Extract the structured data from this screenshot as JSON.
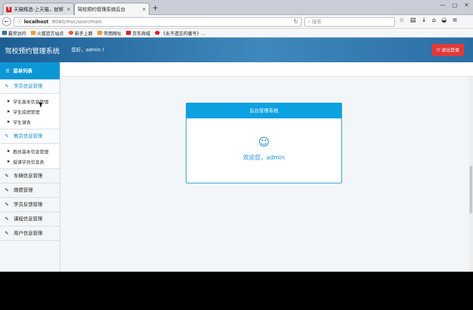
{
  "browser": {
    "tabs": [
      {
        "title": "天猫精选-上天猫，就够了",
        "favicon": "T"
      },
      {
        "title": "驾校预约管理系统后台"
      }
    ],
    "new_tab": "+",
    "url_host": "localhost",
    "url_path": ":8080/mvc/user/main",
    "search_placeholder": "搜索",
    "bookmarks": [
      {
        "label": "最常访问",
        "color": "#3b6fb6"
      },
      {
        "label": "火狐官方站点",
        "color": "#e8a33a"
      },
      {
        "label": "新手上路",
        "color": "#e2622b"
      },
      {
        "label": "常用网址",
        "color": "#e8a33a"
      },
      {
        "label": "京东商城",
        "color": "#d8232a"
      },
      {
        "label": "《永不遗忘的番号》...",
        "color": "#d8232a"
      }
    ]
  },
  "app": {
    "brand": "驾校预约管理系统",
    "greeting": "您好，admin !",
    "logout_label": "退出登录",
    "menu_title": "菜单列表",
    "groups": {
      "student": "学员信息管理",
      "student_items": [
        "学生基本信息管理",
        "学生成绩管理",
        "学生课表"
      ],
      "coach": "教员信息管理",
      "coach_items": [
        "教员基本信息管理",
        "授课学员信息表"
      ],
      "vehicle": "车辆信息管理",
      "payment": "缴费管理",
      "feedback": "学员反馈管理",
      "course": "课程信息管理",
      "user": "用户信息管理"
    },
    "panel": {
      "title": "后台管理系统",
      "smile": "☺",
      "welcome": "欢迎您，admin"
    }
  }
}
